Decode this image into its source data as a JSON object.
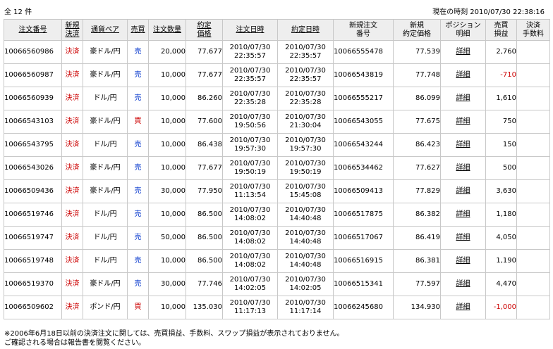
{
  "header": {
    "count_text": "全 12 件",
    "clock_text": "現在の時刻 2010/07/30 22:38:16"
  },
  "columns": {
    "order_no": "注文番号",
    "new_settle": [
      "新規",
      "決済"
    ],
    "pair": "通貨ペア",
    "side": "売買",
    "qty": "注文数量",
    "price": [
      "約定",
      "価格"
    ],
    "order_time": "注文日時",
    "exec_time": "約定日時",
    "new_order_no": [
      "新規注文",
      "番号"
    ],
    "new_price": [
      "新規",
      "約定価格"
    ],
    "position": [
      "ポジション",
      "明細"
    ],
    "pnl": [
      "売買",
      "損益"
    ],
    "fee": [
      "決済",
      "手数料"
    ]
  },
  "rows": [
    {
      "order_no": "10066560986",
      "type": "決済",
      "pair": "豪ドル/円",
      "side": "売",
      "side_color": "blue",
      "qty": "20,000",
      "price": "77.677",
      "order_date": "2010/07/30",
      "order_time": "22:35:57",
      "exec_date": "2010/07/30",
      "exec_time": "22:35:57",
      "new_no": "10066555478",
      "new_price": "77.539",
      "detail": "詳細",
      "pnl": "2,760",
      "pnl_neg": false,
      "fee": ""
    },
    {
      "order_no": "10066560987",
      "type": "決済",
      "pair": "豪ドル/円",
      "side": "売",
      "side_color": "blue",
      "qty": "10,000",
      "price": "77.677",
      "order_date": "2010/07/30",
      "order_time": "22:35:57",
      "exec_date": "2010/07/30",
      "exec_time": "22:35:57",
      "new_no": "10066543819",
      "new_price": "77.748",
      "detail": "詳細",
      "pnl": "-710",
      "pnl_neg": true,
      "fee": ""
    },
    {
      "order_no": "10066560939",
      "type": "決済",
      "pair": "ドル/円",
      "side": "売",
      "side_color": "blue",
      "qty": "10,000",
      "price": "86.260",
      "order_date": "2010/07/30",
      "order_time": "22:35:28",
      "exec_date": "2010/07/30",
      "exec_time": "22:35:28",
      "new_no": "10066555217",
      "new_price": "86.099",
      "detail": "詳細",
      "pnl": "1,610",
      "pnl_neg": false,
      "fee": ""
    },
    {
      "order_no": "10066543103",
      "type": "決済",
      "pair": "豪ドル/円",
      "side": "買",
      "side_color": "red",
      "qty": "10,000",
      "price": "77.600",
      "order_date": "2010/07/30",
      "order_time": "19:50:56",
      "exec_date": "2010/07/30",
      "exec_time": "21:30:04",
      "new_no": "10066543055",
      "new_price": "77.675",
      "detail": "詳細",
      "pnl": "750",
      "pnl_neg": false,
      "fee": ""
    },
    {
      "order_no": "10066543795",
      "type": "決済",
      "pair": "ドル/円",
      "side": "売",
      "side_color": "blue",
      "qty": "10,000",
      "price": "86.438",
      "order_date": "2010/07/30",
      "order_time": "19:57:30",
      "exec_date": "2010/07/30",
      "exec_time": "19:57:30",
      "new_no": "10066543244",
      "new_price": "86.423",
      "detail": "詳細",
      "pnl": "150",
      "pnl_neg": false,
      "fee": ""
    },
    {
      "order_no": "10066543026",
      "type": "決済",
      "pair": "豪ドル/円",
      "side": "売",
      "side_color": "blue",
      "qty": "10,000",
      "price": "77.677",
      "order_date": "2010/07/30",
      "order_time": "19:50:19",
      "exec_date": "2010/07/30",
      "exec_time": "19:50:19",
      "new_no": "10066534462",
      "new_price": "77.627",
      "detail": "詳細",
      "pnl": "500",
      "pnl_neg": false,
      "fee": ""
    },
    {
      "order_no": "10066509436",
      "type": "決済",
      "pair": "豪ドル/円",
      "side": "売",
      "side_color": "blue",
      "qty": "30,000",
      "price": "77.950",
      "order_date": "2010/07/30",
      "order_time": "11:13:54",
      "exec_date": "2010/07/30",
      "exec_time": "15:45:08",
      "new_no": "10066509413",
      "new_price": "77.829",
      "detail": "詳細",
      "pnl": "3,630",
      "pnl_neg": false,
      "fee": ""
    },
    {
      "order_no": "10066519746",
      "type": "決済",
      "pair": "ドル/円",
      "side": "売",
      "side_color": "blue",
      "qty": "10,000",
      "price": "86.500",
      "order_date": "2010/07/30",
      "order_time": "14:08:02",
      "exec_date": "2010/07/30",
      "exec_time": "14:40:48",
      "new_no": "10066517875",
      "new_price": "86.382",
      "detail": "詳細",
      "pnl": "1,180",
      "pnl_neg": false,
      "fee": ""
    },
    {
      "order_no": "10066519747",
      "type": "決済",
      "pair": "ドル/円",
      "side": "売",
      "side_color": "blue",
      "qty": "50,000",
      "price": "86.500",
      "order_date": "2010/07/30",
      "order_time": "14:08:02",
      "exec_date": "2010/07/30",
      "exec_time": "14:40:48",
      "new_no": "10066517067",
      "new_price": "86.419",
      "detail": "詳細",
      "pnl": "4,050",
      "pnl_neg": false,
      "fee": ""
    },
    {
      "order_no": "10066519748",
      "type": "決済",
      "pair": "ドル/円",
      "side": "売",
      "side_color": "blue",
      "qty": "10,000",
      "price": "86.500",
      "order_date": "2010/07/30",
      "order_time": "14:08:02",
      "exec_date": "2010/07/30",
      "exec_time": "14:40:48",
      "new_no": "10066516915",
      "new_price": "86.381",
      "detail": "詳細",
      "pnl": "1,190",
      "pnl_neg": false,
      "fee": ""
    },
    {
      "order_no": "10066519370",
      "type": "決済",
      "pair": "豪ドル/円",
      "side": "売",
      "side_color": "blue",
      "qty": "30,000",
      "price": "77.746",
      "order_date": "2010/07/30",
      "order_time": "14:02:05",
      "exec_date": "2010/07/30",
      "exec_time": "14:02:05",
      "new_no": "10066515341",
      "new_price": "77.597",
      "detail": "詳細",
      "pnl": "4,470",
      "pnl_neg": false,
      "fee": ""
    },
    {
      "order_no": "10066509602",
      "type": "決済",
      "pair": "ポンド/円",
      "side": "買",
      "side_color": "red",
      "qty": "10,000",
      "price": "135.030",
      "order_date": "2010/07/30",
      "order_time": "11:17:13",
      "exec_date": "2010/07/30",
      "exec_time": "11:17:14",
      "new_no": "10066245680",
      "new_price": "134.930",
      "detail": "詳細",
      "pnl": "-1,000",
      "pnl_neg": true,
      "fee": ""
    }
  ],
  "footnote": [
    "※2006年6月18日以前の決済注文に関しては、売買損益、手数料、スワップ損益が表示されておりません。",
    "ご確認される場合は報告書を閲覧ください。"
  ],
  "colors": {
    "sell": "#0033cc",
    "buy": "#cc0000",
    "negative": "#cc0000",
    "header_bg": "#eeeeee",
    "border": "#c8c8c8"
  }
}
